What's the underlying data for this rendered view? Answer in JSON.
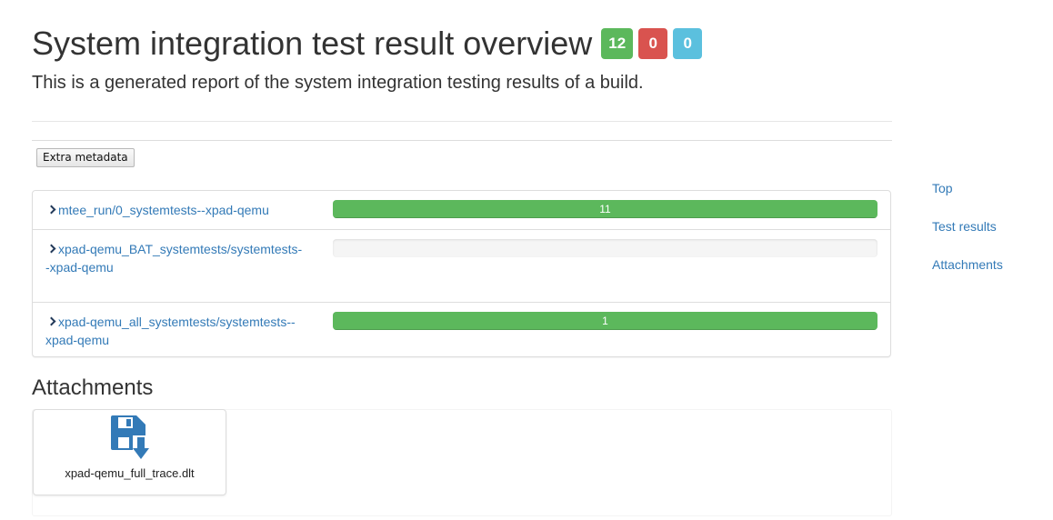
{
  "header": {
    "title": "System integration test result overview",
    "subtitle": "This is a generated report of the system integration testing results of a build.",
    "badges": [
      {
        "value": "12",
        "color": "#5cb85c"
      },
      {
        "value": "0",
        "color": "#d9534f"
      },
      {
        "value": "0",
        "color": "#5bc0de"
      }
    ]
  },
  "metadata_button": "Extra metadata",
  "results": [
    {
      "label": "mtee_run/0_systemtests--xpad-qemu",
      "bar_text": "11",
      "pass_fraction": 1.0,
      "icon": "chevron-right-icon"
    },
    {
      "label": "xpad-qemu_BAT_systemtests/systemtests--xpad-qemu",
      "bar_text": "",
      "pass_fraction": 0.0,
      "icon": "chevron-right-icon"
    },
    {
      "label": "xpad-qemu_all_systemtests/systemtests--xpad-qemu",
      "bar_text": "1",
      "pass_fraction": 1.0,
      "icon": "chevron-right-icon"
    }
  ],
  "attachments": {
    "heading": "Attachments",
    "items": [
      {
        "filename": "xpad-qemu_full_trace.dlt",
        "icon": "floppy-download-icon",
        "icon_color": "#337ab7"
      }
    ]
  },
  "sidenav": {
    "items": [
      "Top",
      "Test results",
      "Attachments"
    ]
  }
}
